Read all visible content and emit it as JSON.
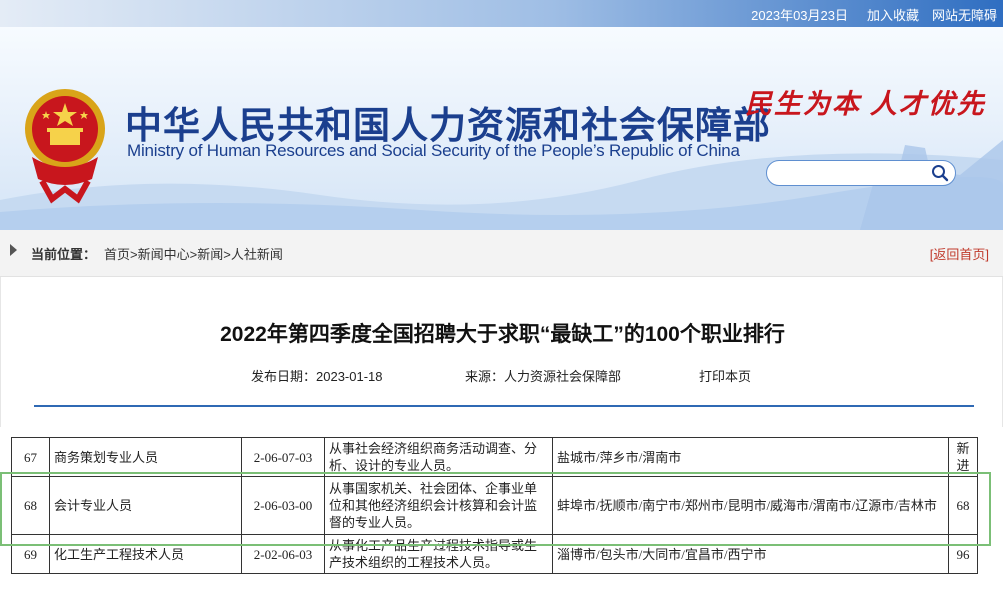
{
  "topbar": {
    "date": "2023年03月23日",
    "add_favorite": "加入收藏",
    "accessibility": "网站无障碍"
  },
  "header": {
    "title_cn": "中华人民共和国人力资源和社会保障部",
    "title_en": "Ministry of Human Resources and Social Security of the People’s Republic of China",
    "slogan": "民生为本 人才优先",
    "search_placeholder": "",
    "emblem_icon": "national-emblem-icon",
    "search_icon": "search-icon"
  },
  "breadcrumb": {
    "label": "当前位置：",
    "items": [
      "首页",
      "新闻中心",
      "新闻",
      "人社新闻"
    ],
    "separator": ">",
    "back_label": "[返回首页]"
  },
  "article": {
    "title": "2022年第四季度全国招聘大于求职“最缺工”的100个职业排行",
    "publish_label": "发布日期：",
    "publish_date": "2023-01-18",
    "source_label": "来源：",
    "source": "人力资源社会保障部",
    "print_label": "打印本页"
  },
  "table": {
    "rows": [
      {
        "rank": "67",
        "occupation": "商务策划专业人员",
        "code": "2-06-07-03",
        "description": "从事社会经济组织商务活动调查、分析、设计的专业人员。",
        "cities": "盐城市/萍乡市/渭南市",
        "change": "新进"
      },
      {
        "rank": "68",
        "occupation": "会计专业人员",
        "code": "2-06-03-00",
        "description": "从事国家机关、社会团体、企事业单位和其他经济组织会计核算和会计监督的专业人员。",
        "cities": "蚌埠市/抚顺市/南宁市/郑州市/昆明市/威海市/渭南市/辽源市/吉林市",
        "change": "68"
      },
      {
        "rank": "69",
        "occupation": "化工生产工程技术人员",
        "code": "2-02-06-03",
        "description": "从事化工产品生产过程技术指导或生产技术组织的工程技术人员。",
        "cities": "淄博市/包头市/大同市/宜昌市/西宁市",
        "change": "96"
      }
    ]
  },
  "colors": {
    "brand_blue": "#1b3f8e",
    "slogan_red": "#c8161d",
    "rule_blue": "#2f69b4",
    "highlight_green": "#7bbf76"
  }
}
